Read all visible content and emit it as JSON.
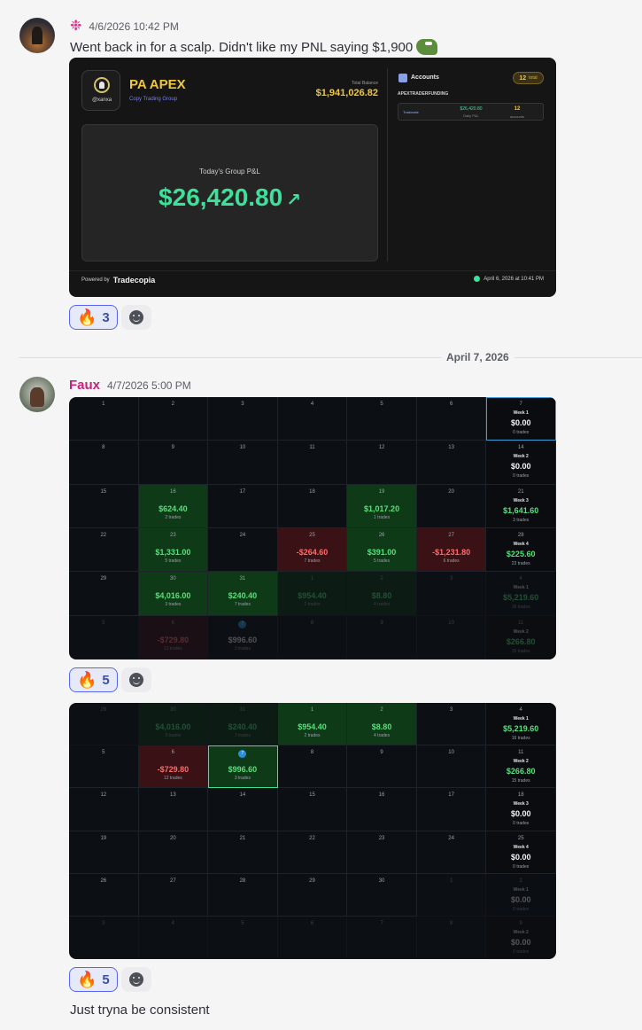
{
  "message1": {
    "timestamp": "4/6/2026 10:42 PM",
    "text": "Went back in for a scalp. Didn't like my PNL saying $1,900",
    "reaction_count": "3"
  },
  "card": {
    "handle": "@xanxa",
    "group_name": "PA APEX",
    "group_sub": "Copy Trading Group",
    "total_balance_label": "Total Balance",
    "total_balance": "$1,941,026.82",
    "pnl_title": "Today's Group P&L",
    "pnl_value": "$26,420.80",
    "accounts_title": "Accounts",
    "accounts_count": "12",
    "accounts_total_label": "total",
    "section": "APEXTRADERFUNDING",
    "row": {
      "brand": "Tradovate",
      "daily_pl": "$26,420.80",
      "daily_pl_label": "Daily P&L",
      "accounts": "12",
      "accounts_label": "accounts"
    },
    "powered_by": "Powered by",
    "brand": "Tradecopia",
    "stamp": "April 6, 2026 at 10:41 PM"
  },
  "date_divider": "April 7, 2026",
  "message2": {
    "username": "Faux",
    "timestamp": "4/7/2026 5:00 PM",
    "reaction_count_1": "5",
    "reaction_count_2": "5",
    "final_text": "Just tryna be consistent"
  },
  "calendar1": [
    {
      "d": "1"
    },
    {
      "d": "2"
    },
    {
      "d": "3"
    },
    {
      "d": "4"
    },
    {
      "d": "5"
    },
    {
      "d": "6"
    },
    {
      "d": "7",
      "week": "Week 1",
      "amt": "$0.00",
      "tr": "0 trades",
      "kind": "week-today"
    },
    {
      "d": "8"
    },
    {
      "d": "9"
    },
    {
      "d": "10"
    },
    {
      "d": "11"
    },
    {
      "d": "12"
    },
    {
      "d": "13"
    },
    {
      "d": "14",
      "week": "Week 2",
      "amt": "$0.00",
      "tr": "0 trades",
      "kind": "week"
    },
    {
      "d": "15"
    },
    {
      "d": "16",
      "amt": "$624.40",
      "tr": "2 trades",
      "kind": "win"
    },
    {
      "d": "17"
    },
    {
      "d": "18"
    },
    {
      "d": "19",
      "amt": "$1,017.20",
      "tr": "1 trades",
      "kind": "win"
    },
    {
      "d": "20"
    },
    {
      "d": "21",
      "week": "Week 3",
      "amt": "$1,641.60",
      "tr": "3 trades",
      "kind": "week-pos"
    },
    {
      "d": "22"
    },
    {
      "d": "23",
      "amt": "$1,331.00",
      "tr": "5 trades",
      "kind": "win"
    },
    {
      "d": "24"
    },
    {
      "d": "25",
      "amt": "-$264.60",
      "tr": "7 trades",
      "kind": "loss"
    },
    {
      "d": "26",
      "amt": "$391.00",
      "tr": "5 trades",
      "kind": "win"
    },
    {
      "d": "27",
      "amt": "-$1,231.80",
      "tr": "6 trades",
      "kind": "loss"
    },
    {
      "d": "28",
      "week": "Week 4",
      "amt": "$225.60",
      "tr": "23 trades",
      "kind": "week-pos"
    },
    {
      "d": "29"
    },
    {
      "d": "30",
      "amt": "$4,016.00",
      "tr": "3 trades",
      "kind": "win"
    },
    {
      "d": "31",
      "amt": "$240.40",
      "tr": "7 trades",
      "kind": "win"
    },
    {
      "d": "1",
      "amt": "$954.40",
      "tr": "2 trades",
      "kind": "win-faded"
    },
    {
      "d": "2",
      "amt": "$8.80",
      "tr": "4 trades",
      "kind": "win-faded"
    },
    {
      "d": "3",
      "kind": "faded"
    },
    {
      "d": "4",
      "week": "Week 1",
      "amt": "$5,219.60",
      "tr": "16 trades",
      "kind": "week-pos-faded"
    },
    {
      "d": "5",
      "kind": "faded"
    },
    {
      "d": "6",
      "amt": "-$729.80",
      "tr": "12 trades",
      "kind": "loss-faded"
    },
    {
      "d": "7",
      "amt": "$996.60",
      "tr": "3 trades",
      "kind": "faded-badge"
    },
    {
      "d": "8",
      "kind": "faded"
    },
    {
      "d": "9",
      "kind": "faded"
    },
    {
      "d": "10",
      "kind": "faded"
    },
    {
      "d": "11",
      "week": "Week 2",
      "amt": "$266.80",
      "tr": "15 trades",
      "kind": "week-pos-faded"
    }
  ],
  "calendar2": [
    {
      "d": "29",
      "kind": "faded"
    },
    {
      "d": "30",
      "amt": "$4,016.00",
      "tr": "3 trades",
      "kind": "win-faded"
    },
    {
      "d": "31",
      "amt": "$240.40",
      "tr": "7 trades",
      "kind": "win-faded"
    },
    {
      "d": "1",
      "amt": "$954.40",
      "tr": "2 trades",
      "kind": "win"
    },
    {
      "d": "2",
      "amt": "$8.80",
      "tr": "4 trades",
      "kind": "win"
    },
    {
      "d": "3"
    },
    {
      "d": "4",
      "week": "Week 1",
      "amt": "$5,219.60",
      "tr": "16 trades",
      "kind": "week-pos"
    },
    {
      "d": "5"
    },
    {
      "d": "6",
      "amt": "-$729.80",
      "tr": "12 trades",
      "kind": "loss"
    },
    {
      "d": "7",
      "amt": "$996.60",
      "tr": "3 trades",
      "kind": "win-sel-badge"
    },
    {
      "d": "8"
    },
    {
      "d": "9"
    },
    {
      "d": "10"
    },
    {
      "d": "11",
      "week": "Week 2",
      "amt": "$266.80",
      "tr": "15 trades",
      "kind": "week-pos"
    },
    {
      "d": "12"
    },
    {
      "d": "13"
    },
    {
      "d": "14"
    },
    {
      "d": "15"
    },
    {
      "d": "16"
    },
    {
      "d": "17"
    },
    {
      "d": "18",
      "week": "Week 3",
      "amt": "$0.00",
      "tr": "0 trades",
      "kind": "week"
    },
    {
      "d": "19"
    },
    {
      "d": "20"
    },
    {
      "d": "21"
    },
    {
      "d": "22"
    },
    {
      "d": "23"
    },
    {
      "d": "24"
    },
    {
      "d": "25",
      "week": "Week 4",
      "amt": "$0.00",
      "tr": "0 trades",
      "kind": "week"
    },
    {
      "d": "26"
    },
    {
      "d": "27"
    },
    {
      "d": "28"
    },
    {
      "d": "29"
    },
    {
      "d": "30"
    },
    {
      "d": "1",
      "kind": "faded"
    },
    {
      "d": "2",
      "week": "Week 1",
      "amt": "$0.00",
      "tr": "0 trades",
      "kind": "week-faded"
    },
    {
      "d": "3",
      "kind": "faded"
    },
    {
      "d": "4",
      "kind": "faded"
    },
    {
      "d": "5",
      "kind": "faded"
    },
    {
      "d": "6",
      "kind": "faded"
    },
    {
      "d": "7",
      "kind": "faded"
    },
    {
      "d": "8",
      "kind": "faded"
    },
    {
      "d": "9",
      "week": "Week 2",
      "amt": "$0.00",
      "tr": "0 trades",
      "kind": "week-faded"
    }
  ]
}
